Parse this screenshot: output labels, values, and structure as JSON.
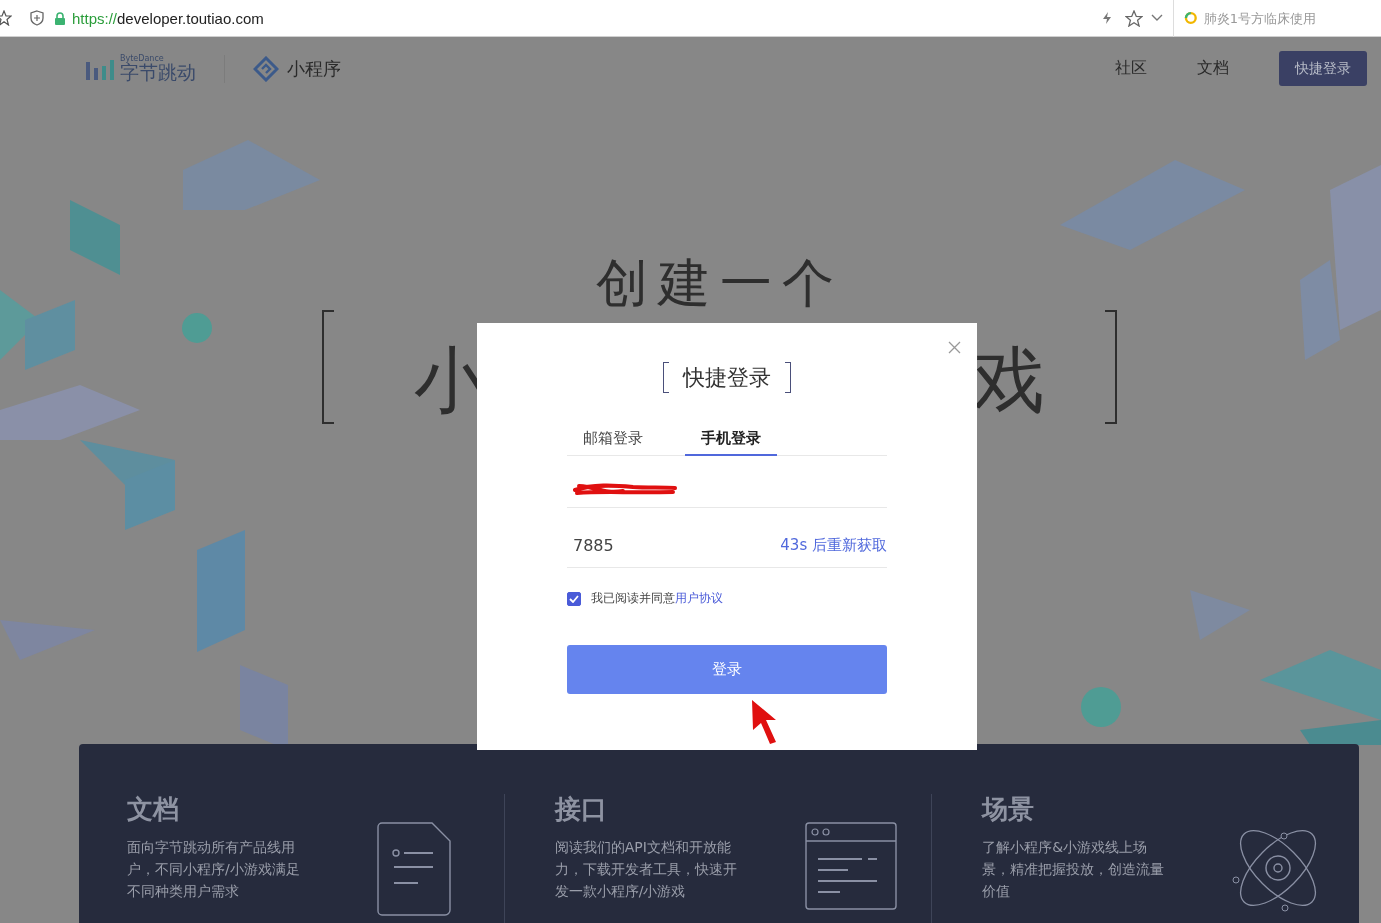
{
  "browser": {
    "url_scheme": "https://",
    "url_host": "developer.toutiao.com",
    "search_placeholder": "肺炎1号方临床使用"
  },
  "header": {
    "brand_small": "ByteDance",
    "brand": "字节跳动",
    "product": "小程序",
    "nav": [
      "社区",
      "文档"
    ],
    "login_button": "快捷登录"
  },
  "hero": {
    "line_1": "创建一个",
    "line_2_left": "小",
    "line_2_right": "戏"
  },
  "modal": {
    "title": "快捷登录",
    "tabs": [
      {
        "label": "邮箱登录",
        "selected": false
      },
      {
        "label": "手机登录",
        "selected": true
      }
    ],
    "code_value": "7885",
    "resend": "43s 后重新获取",
    "agree": {
      "checked": true,
      "text": "我已阅读并同意",
      "link": "用户协议"
    },
    "submit": "登录"
  },
  "features": [
    {
      "kind": "document",
      "title": "文档",
      "text": "面向字节跳动所有产品线用户，不同小程序/小游戏满足不同种类用户需求"
    },
    {
      "kind": "window",
      "title": "接口",
      "text": "阅读我们的API文档和开放能力，下载开发者工具，快速开发一款小程序/小游戏"
    },
    {
      "kind": "orbit",
      "title": "场景",
      "text": "了解小程序&小游戏线上场景，精准把握投放，创造流量价值"
    }
  ]
}
